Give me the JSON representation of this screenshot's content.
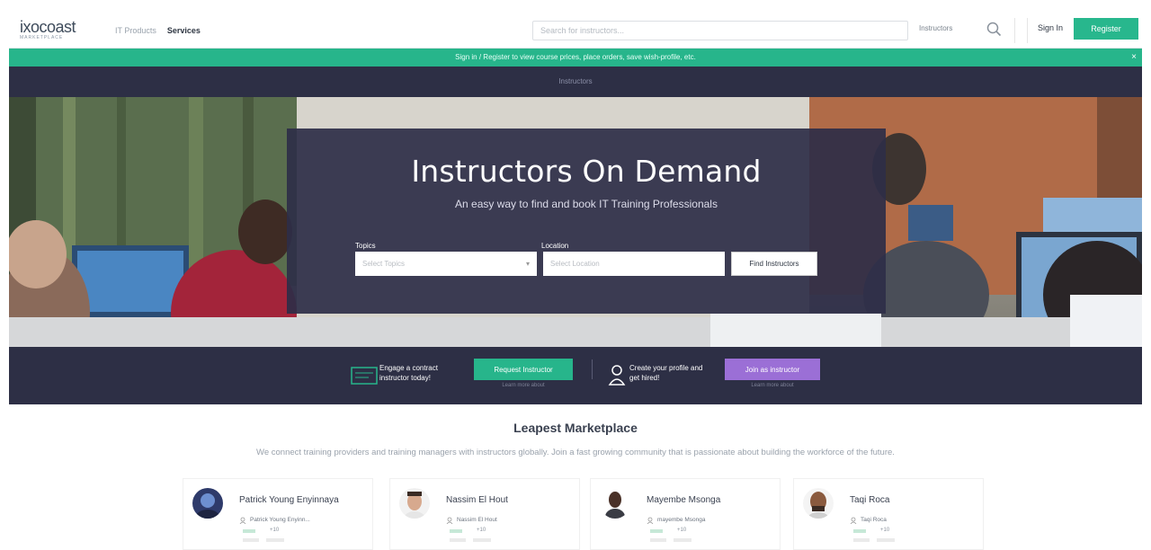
{
  "nav": {
    "logo_main": "ixocoast",
    "logo_sub": "MARKETPLACE",
    "links": [
      "IT Products",
      "Services"
    ],
    "search_placeholder": "Search for instructors...",
    "instructors_dropdown": "Instructors",
    "sign_in": "Sign In",
    "register": "Register"
  },
  "banner": {
    "text": "Sign in / Register to view course prices, place orders, save wish-profile, etc.",
    "close": "×"
  },
  "dark_strip": {
    "text": "Instructors"
  },
  "hero": {
    "title": "Instructors On Demand",
    "subtitle": "An easy way to find and book IT Training Professionals",
    "topics_label": "Topics",
    "topics_placeholder": "Select Topics",
    "location_label": "Location",
    "location_placeholder": "Select Location",
    "find_button": "Find Instructors"
  },
  "cta": {
    "engage_text": "Engage a contract instructor today!",
    "engage_button": "Request Instructor",
    "engage_sub": "Learn more about",
    "profile_text": "Create your profile and get hired!",
    "join_button": "Join as instructor",
    "join_sub": "Learn more about"
  },
  "marketplace": {
    "title": "Leapest Marketplace",
    "subtitle": "We connect training providers and training managers with instructors globally. Join a fast growing community that is passionate about building the workforce of the future.",
    "cards": [
      {
        "name": "Patrick Young Enyinnaya",
        "handle": "Patrick Young Enyinn...",
        "stat": "+10"
      },
      {
        "name": "Nassim El Hout",
        "handle": "Nassim El Hout",
        "stat": "+10"
      },
      {
        "name": "Mayembe Msonga",
        "handle": "mayembe Msonga",
        "stat": "+10"
      },
      {
        "name": "Taqi Roca",
        "handle": "Taqi Roca",
        "stat": "+10"
      }
    ]
  },
  "colors": {
    "accent_green": "#27b58b",
    "dark_navy": "#2d2f45",
    "purple": "#9b6fd6"
  }
}
